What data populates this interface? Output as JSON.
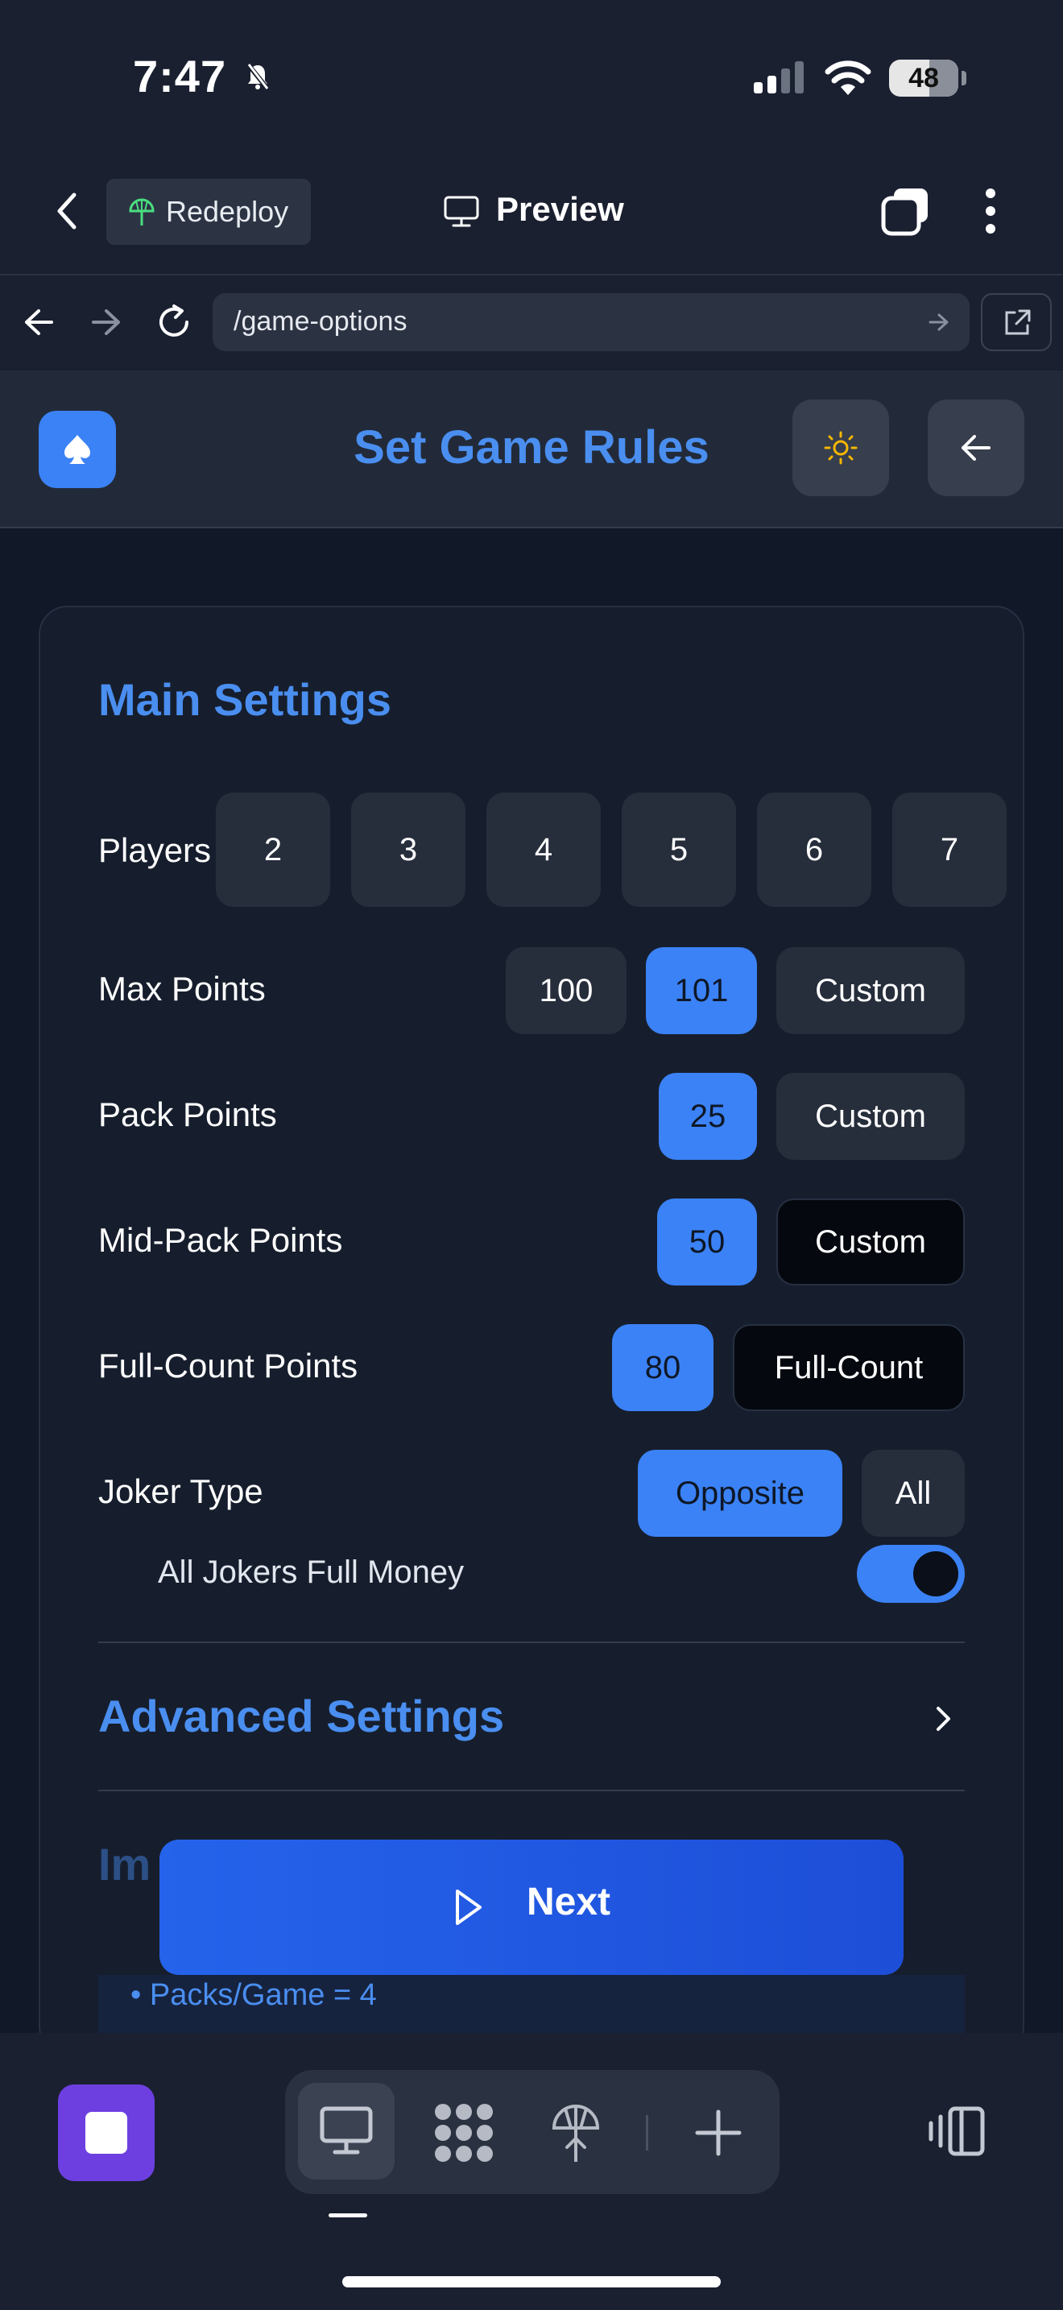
{
  "status_bar": {
    "time": "7:47",
    "battery": "48"
  },
  "browser": {
    "redeploy_label": "Redeploy",
    "preview_label": "Preview",
    "url": "/game-options"
  },
  "app": {
    "title": "Set Game Rules"
  },
  "main_settings": {
    "title": "Main Settings",
    "players": {
      "label": "Players",
      "options": [
        "2",
        "3",
        "4",
        "5",
        "6",
        "7"
      ]
    },
    "max_points": {
      "label": "Max Points",
      "options": [
        "100",
        "101",
        "Custom"
      ],
      "selected": "101"
    },
    "pack_points": {
      "label": "Pack Points",
      "options": [
        "25",
        "Custom"
      ],
      "selected": "25"
    },
    "mid_pack_points": {
      "label": "Mid-Pack Points",
      "options": [
        "50",
        "Custom"
      ],
      "selected": "50"
    },
    "full_count_points": {
      "label": "Full-Count Points",
      "options": [
        "80",
        "Full-Count"
      ],
      "selected": "80"
    },
    "joker_type": {
      "label": "Joker Type",
      "options": [
        "Opposite",
        "All"
      ],
      "selected": "Opposite"
    },
    "all_jokers_full_money": {
      "label": "All Jokers Full Money",
      "enabled": true
    }
  },
  "advanced_settings": {
    "title": "Advanced Settings"
  },
  "partial_section_title": "Im",
  "info_line": "• Packs/Game = 4",
  "next_button": "Next",
  "colors": {
    "accent": "#3b82f6",
    "title_blue": "#4a8ef0",
    "background": "#111827",
    "stop_purple": "#6d3fe0"
  }
}
